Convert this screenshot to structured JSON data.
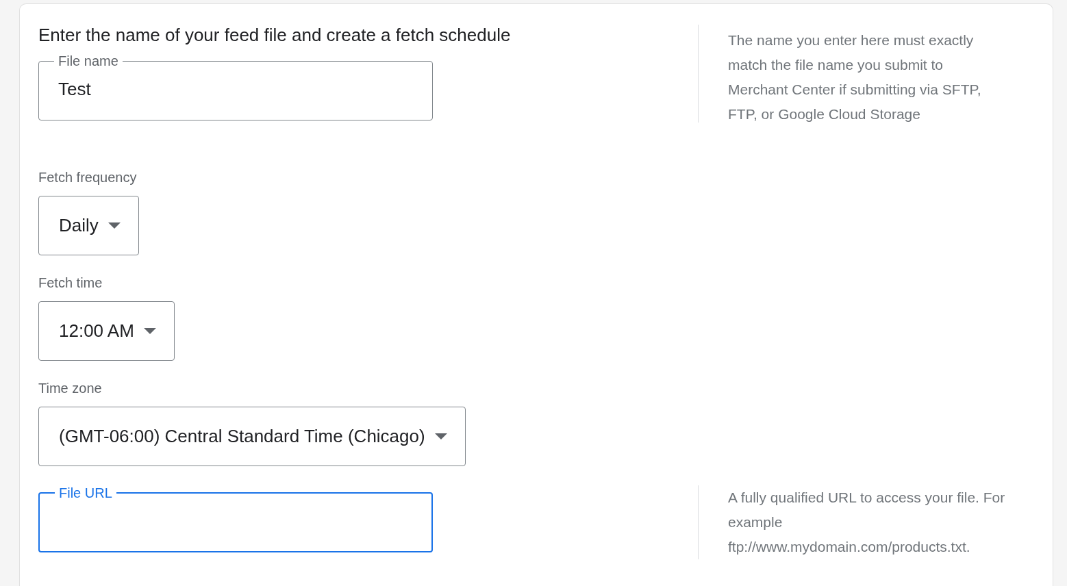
{
  "heading": "Enter the name of your feed file and create a fetch schedule",
  "fields": [
    {
      "kind": "text",
      "label": "File name",
      "value": "Test",
      "focused": false,
      "help": "The name you enter here must exactly match the file name you submit to Merchant Center if submitting via SFTP, FTP, or Google Cloud Storage"
    },
    {
      "kind": "dropdown",
      "label": "Fetch frequency",
      "value": "Daily"
    },
    {
      "kind": "dropdown",
      "label": "Fetch time",
      "value": "12:00 AM"
    },
    {
      "kind": "dropdown",
      "label": "Time zone",
      "value": "(GMT-06:00) Central Standard Time (Chicago)"
    },
    {
      "kind": "text",
      "label": "File URL",
      "focused": true,
      "help": "A fully qualified URL to access your file. For example ftp://www.mydomain.com/products.txt."
    }
  ]
}
